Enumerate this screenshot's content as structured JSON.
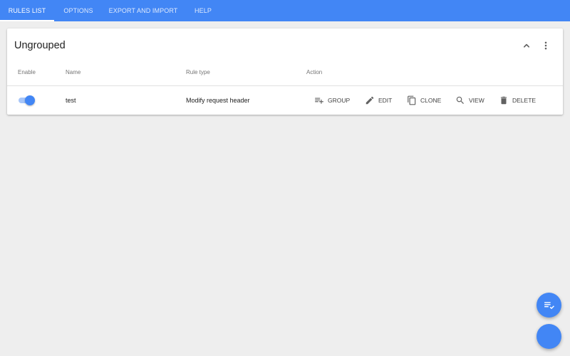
{
  "nav": {
    "tabs": [
      {
        "label": "RULES LIST",
        "active": true
      },
      {
        "label": "OPTIONS",
        "active": false
      },
      {
        "label": "EXPORT AND IMPORT",
        "active": false
      },
      {
        "label": "HELP",
        "active": false
      }
    ]
  },
  "group": {
    "title": "Ungrouped",
    "columns": {
      "enable": "Enable",
      "name": "Name",
      "rule_type": "Rule type",
      "action": "Action"
    },
    "rules": [
      {
        "enabled": true,
        "name": "test",
        "rule_type": "Modify request header",
        "actions": {
          "group": "GROUP",
          "edit": "EDIT",
          "clone": "CLONE",
          "view": "VIEW",
          "delete": "DELETE"
        }
      }
    ]
  },
  "colors": {
    "primary": "#4286f5",
    "background": "#eeeeee",
    "card": "#ffffff"
  },
  "icons": [
    "chevron-up-icon",
    "more-vert-icon",
    "playlist-add-icon",
    "pencil-icon",
    "copy-icon",
    "search-icon",
    "trash-icon",
    "playlist-check-icon"
  ]
}
